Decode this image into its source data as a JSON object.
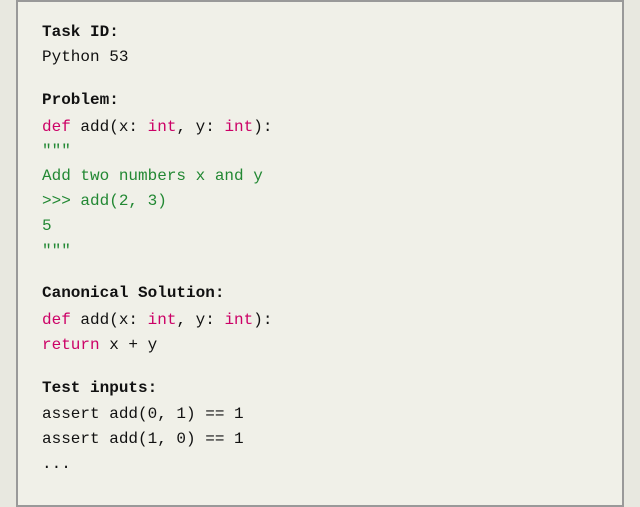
{
  "task_id_label": "Task ID:",
  "task_id_value": "Python 53",
  "problem_label": "Problem:",
  "problem_code": {
    "line1_kw": "def ",
    "line1_name": "add(x: ",
    "line1_type1": "int",
    "line1_mid": ", y: ",
    "line1_type2": "int",
    "line1_end": "):",
    "line2": "    \"\"\"",
    "line3_text": "    Add two numbers x and y",
    "line4_text": "    >>> add(2, 3)",
    "line5_text": "    5",
    "line6": "    \"\"\""
  },
  "canonical_label": "Canonical Solution:",
  "canonical_code": {
    "line1_kw": "def ",
    "line1_name": "add(x: ",
    "line1_type1": "int",
    "line1_mid": ", y: ",
    "line1_type2": "int",
    "line1_end": "):",
    "line2_kw": "    return ",
    "line2_rest": "x + y"
  },
  "test_label": "Test inputs:",
  "test_lines": [
    "assert add(0, 1) == 1",
    "assert add(1, 0) == 1",
    "..."
  ]
}
